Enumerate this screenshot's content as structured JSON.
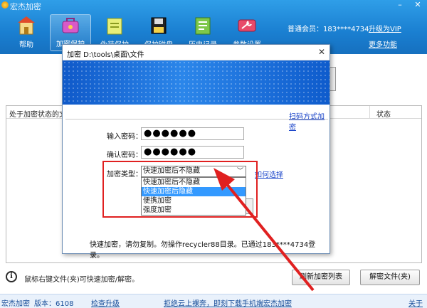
{
  "app": {
    "title": "宏杰加密"
  },
  "window_controls": {
    "minimize": "–",
    "close": "✕"
  },
  "toolbar": [
    {
      "label": "帮助",
      "icon": "home-icon"
    },
    {
      "label": "加密保护",
      "icon": "bag-icon"
    },
    {
      "label": "伪装保护",
      "icon": "folder-icon"
    },
    {
      "label": "保护磁盘",
      "icon": "disk-icon"
    },
    {
      "label": "历史记录",
      "icon": "history-icon"
    },
    {
      "label": "参数设置",
      "icon": "wrench-icon"
    }
  ],
  "account": {
    "member": "普通会员：183****4734",
    "upgrade": "升级为VIP",
    "more": "更多功能"
  },
  "list": {
    "col_file": "处于加密状态的文件",
    "col_status": "状态"
  },
  "bottom": {
    "hint": "鼠标右键文件(夹)可快速加密/解密。",
    "refresh_btn": "刷新加密列表",
    "decrypt_btn": "解密文件(夹)"
  },
  "statusbar": {
    "brand": "宏杰加密",
    "version": "版本：6108",
    "check_update": "检查升级",
    "promo": "拒绝云上裸奔，即刻下载手机端宏杰加密",
    "about": "关于"
  },
  "dialog": {
    "title": "加密 D:\\tools\\桌面\\文件",
    "close": "✕",
    "scan_link": "扫码方式加密",
    "password_label": "输入密码：",
    "password_value": "●●●●●●",
    "confirm_label": "确认密码：",
    "confirm_value": "●●●●●●",
    "type_label": "加密类型：",
    "type_selected": "快速加密后不隐藏",
    "how_link": "如何选择",
    "options": [
      "快速加密后不隐藏",
      "快速加密后隐藏",
      "便携加密",
      "强度加密"
    ],
    "highlighted_option_index": 1,
    "footer": "快速加密，请勿复制。勿操作recycler88目录。已通过183****4734登录。"
  },
  "colors": {
    "header_blue": "#1a7fd1",
    "highlight_red": "#e02020",
    "link_blue": "#1a44c9",
    "selected_blue": "#3399ff"
  }
}
